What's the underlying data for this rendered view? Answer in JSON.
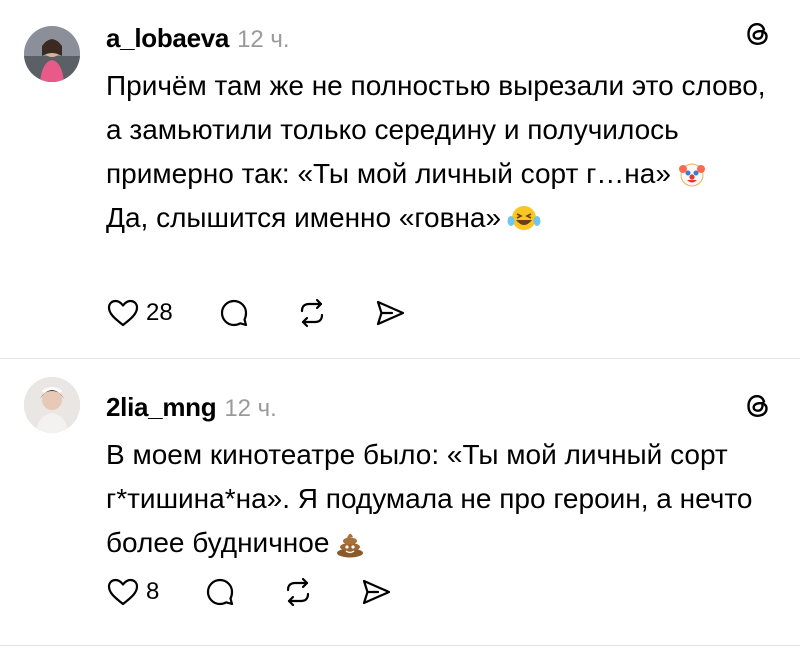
{
  "posts": [
    {
      "username": "a_lobaeva",
      "time": "12 ч.",
      "avatar_icon": "user-photo-avatar",
      "text_paragraphs": [
        "Причём там же не полностью вырезали это слово, а замьютили только середину и получилось примерно так: «Ты мой личный сорт г…на»",
        "Да, слышится именно «говна»"
      ],
      "emoji": [
        "clown-face-icon",
        "laughing-tears-icon"
      ],
      "likes": "28"
    },
    {
      "username": "2lia_mng",
      "time": "12 ч.",
      "avatar_icon": "user-photo-avatar",
      "text_paragraphs": [
        "В моем кинотеатре было: «Ты мой личный сорт г*тишина*на». Я подумала не про героин, а нечто более будничное"
      ],
      "emoji": [
        "pile-of-poo-icon"
      ],
      "likes": "8"
    }
  ],
  "icons": {
    "like": "heart-icon",
    "reply": "comment-icon",
    "repost": "repost-icon",
    "share": "send-icon",
    "brand": "threads-logo-icon"
  }
}
